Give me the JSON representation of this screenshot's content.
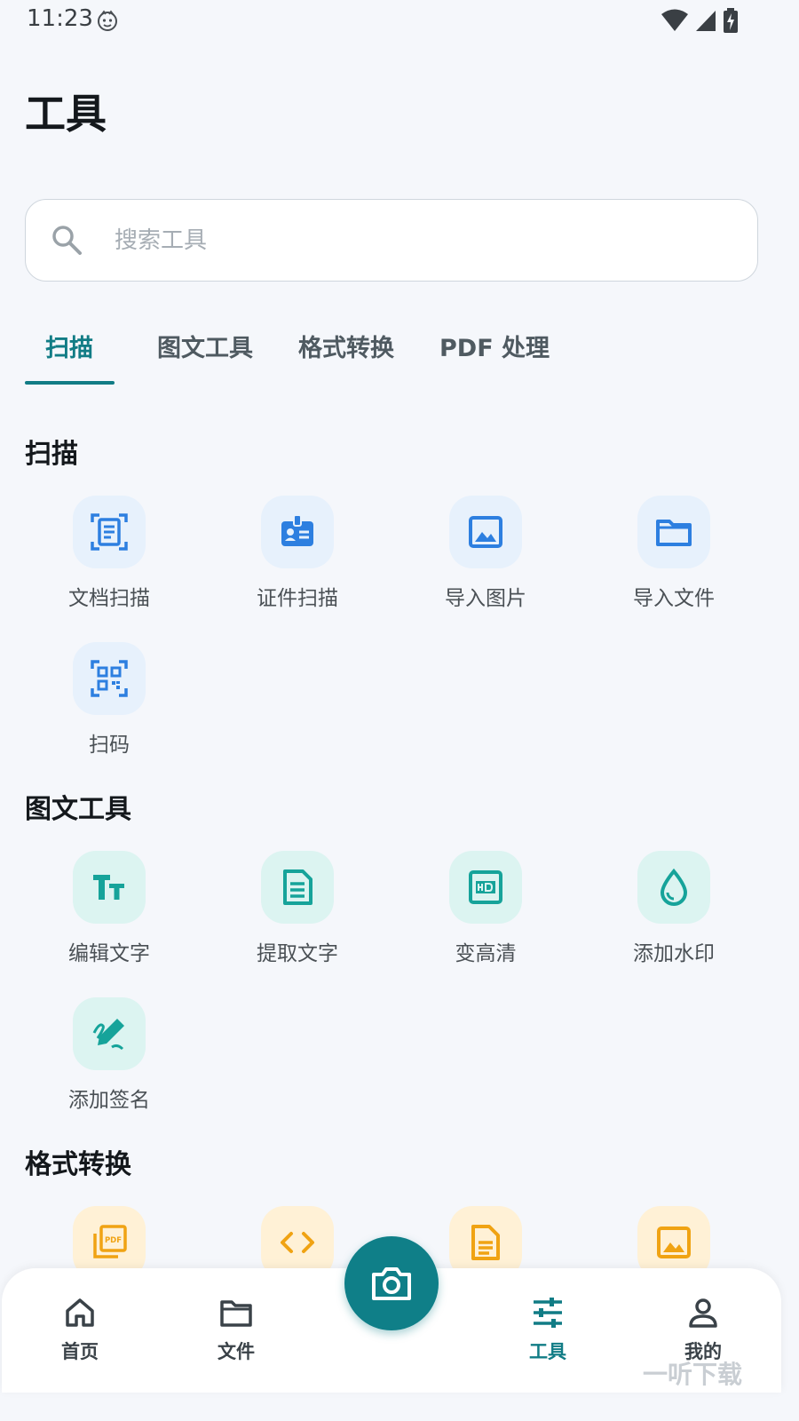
{
  "status_bar": {
    "time": "11:23"
  },
  "page": {
    "title": "工具"
  },
  "search": {
    "placeholder": "搜索工具"
  },
  "tabs": [
    {
      "label": "扫描",
      "active": true
    },
    {
      "label": "图文工具",
      "active": false
    },
    {
      "label": "格式转换",
      "active": false
    },
    {
      "label": "PDF 处理",
      "active": false
    }
  ],
  "sections": {
    "scan": {
      "title": "扫描",
      "items": [
        {
          "label": "文档扫描",
          "icon": "document-scan-icon"
        },
        {
          "label": "证件扫描",
          "icon": "id-card-icon"
        },
        {
          "label": "导入图片",
          "icon": "image-icon"
        },
        {
          "label": "导入文件",
          "icon": "folder-icon"
        },
        {
          "label": "扫码",
          "icon": "qr-code-icon"
        }
      ]
    },
    "image_text": {
      "title": "图文工具",
      "items": [
        {
          "label": "编辑文字",
          "icon": "text-size-icon"
        },
        {
          "label": "提取文字",
          "icon": "text-document-icon"
        },
        {
          "label": "变高清",
          "icon": "hd-icon"
        },
        {
          "label": "添加水印",
          "icon": "water-drop-icon"
        },
        {
          "label": "添加签名",
          "icon": "signature-icon"
        }
      ]
    },
    "format": {
      "title": "格式转换",
      "items": [
        {
          "icon": "pdf-stack-icon"
        },
        {
          "icon": "code-icon"
        },
        {
          "icon": "document-icon"
        },
        {
          "icon": "image-icon"
        }
      ]
    }
  },
  "bottom_nav": [
    {
      "label": "首页",
      "icon": "home-icon",
      "active": false
    },
    {
      "label": "文件",
      "icon": "folder-icon",
      "active": false
    },
    {
      "label": "工具",
      "icon": "sliders-icon",
      "active": true
    },
    {
      "label": "我的",
      "icon": "person-icon",
      "active": false
    }
  ],
  "fab": {
    "icon": "camera-icon"
  },
  "watermark": "一听下载",
  "colors": {
    "accent": "#117c85",
    "blue": "#2d7fe0",
    "teal": "#16a39a",
    "orange": "#f0a313",
    "background": "#f5f7fb"
  }
}
